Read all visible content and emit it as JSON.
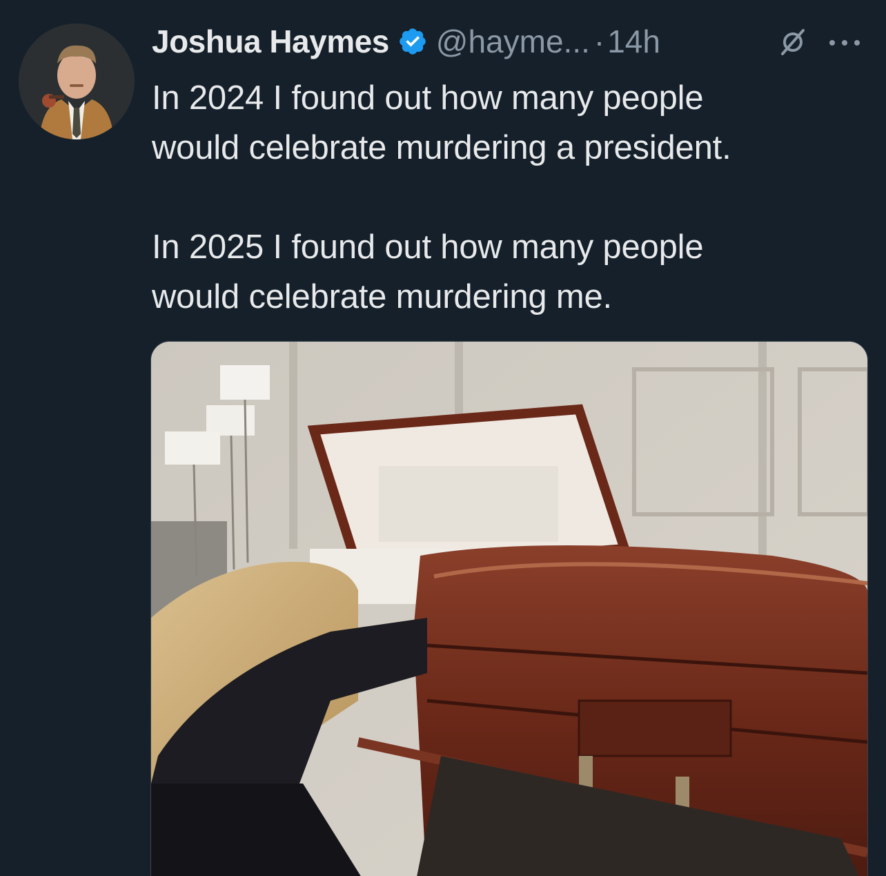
{
  "tweet": {
    "author": {
      "display_name": "Joshua Haymes",
      "handle": "@hayme...",
      "verified": true
    },
    "separator": "·",
    "time": "14h",
    "text": "In 2024 I found out how many people\nwould celebrate murdering a president.\n\nIn 2025 I found out how many people\nwould celebrate murdering me.",
    "icons": {
      "avatar": "avatar",
      "verified": "verified-badge-icon",
      "grok": "grok-icon",
      "more": "more-options-icon"
    },
    "colors": {
      "background": "#15202b",
      "text": "#e7e9ea",
      "secondary": "#8b98a5",
      "verified": "#1d9bf0"
    }
  }
}
